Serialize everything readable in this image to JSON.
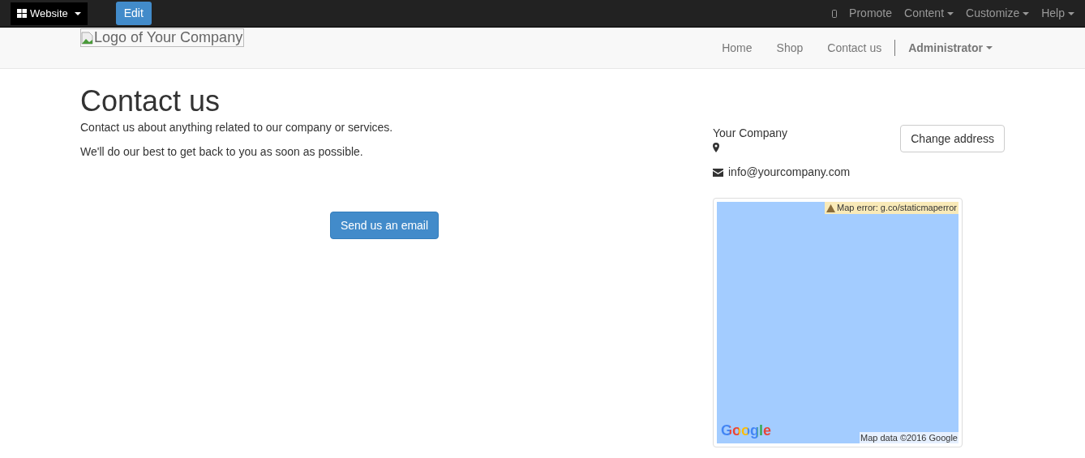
{
  "admin_bar": {
    "website_menu": "Website",
    "edit_button": "Edit",
    "right_items": [
      {
        "label": "Promote",
        "dropdown": false
      },
      {
        "label": "Content",
        "dropdown": true
      },
      {
        "label": "Customize",
        "dropdown": true
      },
      {
        "label": "Help",
        "dropdown": true
      }
    ]
  },
  "navbar": {
    "logo_alt": "Logo of Your Company",
    "links": [
      {
        "label": "Home",
        "selected": false
      },
      {
        "label": "Shop",
        "selected": false
      },
      {
        "label": "Contact us",
        "selected": false
      }
    ],
    "user_menu": "Administrator"
  },
  "page": {
    "title": "Contact us",
    "paragraphs": [
      "Contact us about anything related to our company or services.",
      "We'll do our best to get back to you as soon as possible."
    ],
    "email_button": "Send us an email"
  },
  "company": {
    "name": "Your Company",
    "email": "info@yourcompany.com",
    "change_address_button": "Change address"
  },
  "map": {
    "error": "Map error: g.co/staticmaperror",
    "logo": "Google",
    "attribution": "Map data ©2016 Google"
  }
}
